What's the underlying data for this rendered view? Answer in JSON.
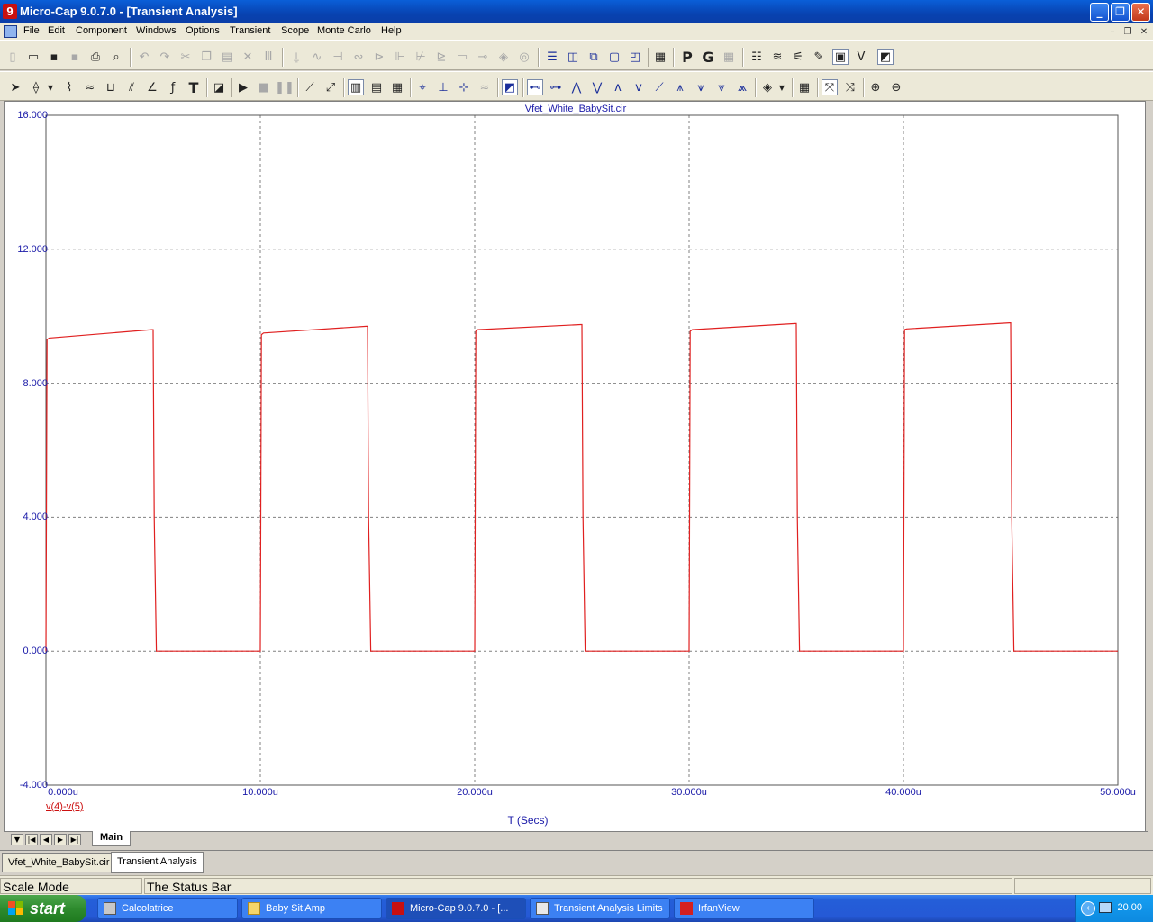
{
  "window": {
    "title": "Micro-Cap 9.0.7.0 - [Transient Analysis]",
    "app_icon": "9"
  },
  "menu": [
    "File",
    "Edit",
    "Component",
    "Windows",
    "Options",
    "Transient",
    "Scope",
    "Monte Carlo",
    "Help"
  ],
  "plot": {
    "title": "Vfet_White_BabySit.cir",
    "x_axis_label": "T (Secs)",
    "series_label": "v(4)-v(5)",
    "series_color": "#e02020",
    "grid_color": "#808080",
    "y_ticks": [
      "16.000",
      "12.000",
      "8.000",
      "4.000",
      "0.000",
      "-4.000"
    ],
    "x_ticks": [
      "0.000u",
      "10.000u",
      "20.000u",
      "30.000u",
      "40.000u",
      "50.000u"
    ]
  },
  "chart_data": {
    "type": "line",
    "title": "Vfet_White_BabySit.cir",
    "xlabel": "T (Secs)",
    "ylabel": "",
    "xlim": [
      0,
      50
    ],
    "ylim": [
      -4,
      16
    ],
    "x_unit": "u",
    "grid": true,
    "series": [
      {
        "name": "v(4)-v(5)",
        "color": "#e02020",
        "x": [
          0,
          0.05,
          0.15,
          4.95,
          5.0,
          5.05,
          5.15,
          10.0,
          10.05,
          10.15,
          14.95,
          15.0,
          15.05,
          15.15,
          20.0,
          20.05,
          20.15,
          24.95,
          25.0,
          25.05,
          25.15,
          30.0,
          30.05,
          30.15,
          34.95,
          35.0,
          35.05,
          35.15,
          40.0,
          40.05,
          40.15,
          44.95,
          45.0,
          45.05,
          45.15,
          50.0
        ],
        "y": [
          0,
          9.3,
          9.35,
          9.6,
          9.6,
          4.0,
          0,
          0,
          9.45,
          9.5,
          9.7,
          9.7,
          4.0,
          0,
          0,
          9.55,
          9.6,
          9.75,
          9.75,
          4.0,
          0,
          0,
          9.55,
          9.6,
          9.78,
          9.78,
          4.0,
          0,
          0,
          9.6,
          9.62,
          9.8,
          9.8,
          4.0,
          0,
          0
        ]
      }
    ]
  },
  "page_tabs": {
    "main_label": "Main"
  },
  "doc_tabs": [
    "Vfet_White_BabySit.cir",
    "Transient Analysis"
  ],
  "status": {
    "mode": "Scale Mode",
    "message": "The Status Bar"
  },
  "taskbar": {
    "start_label": "start",
    "tasks": [
      "Calcolatrice",
      "Baby Sit Amp",
      "Micro-Cap 9.0.7.0 - [...",
      "Transient Analysis Limits",
      "IrfanView"
    ],
    "clock": "20.00"
  },
  "toolbar_icons": {
    "t1": [
      "new-icon",
      "open-icon",
      "save-icon",
      "save-all-icon",
      "print-icon",
      "print-preview-icon",
      "undo-icon",
      "redo-icon",
      "cut-icon",
      "copy-icon",
      "paste-icon",
      "delete-icon",
      "select-all-icon",
      "ground-icon",
      "resistor-icon",
      "capacitor-icon",
      "inductor-icon",
      "diode-icon",
      "battery-icon",
      "npn-icon",
      "nmos-icon",
      "opamp-icon",
      "switch-icon",
      "source-icon",
      "tile-h-icon",
      "tile-v-icon",
      "cascade-icon",
      "window-icon",
      "split-icon",
      "calculator-icon",
      "p-icon",
      "g-icon",
      "grid-icon",
      "component-list-icon",
      "waveform-icon",
      "probe-icon",
      "pen-icon",
      "plot-props-icon",
      "vp-icon",
      "snapshot-icon"
    ],
    "t2": [
      "select-icon",
      "component-icon",
      "wire-icon",
      "bus-icon",
      "text-icon",
      "properties-icon",
      "run-icon",
      "stop-icon",
      "pause-icon",
      "line-icon",
      "diagonal-icon",
      "grid-bold-icon",
      "grid-minor-icon",
      "grid-none-icon",
      "cursor-icon",
      "peak-icon",
      "valley-icon",
      "slope-icon",
      "zoom-in-icon",
      "zoom-out-icon"
    ]
  }
}
